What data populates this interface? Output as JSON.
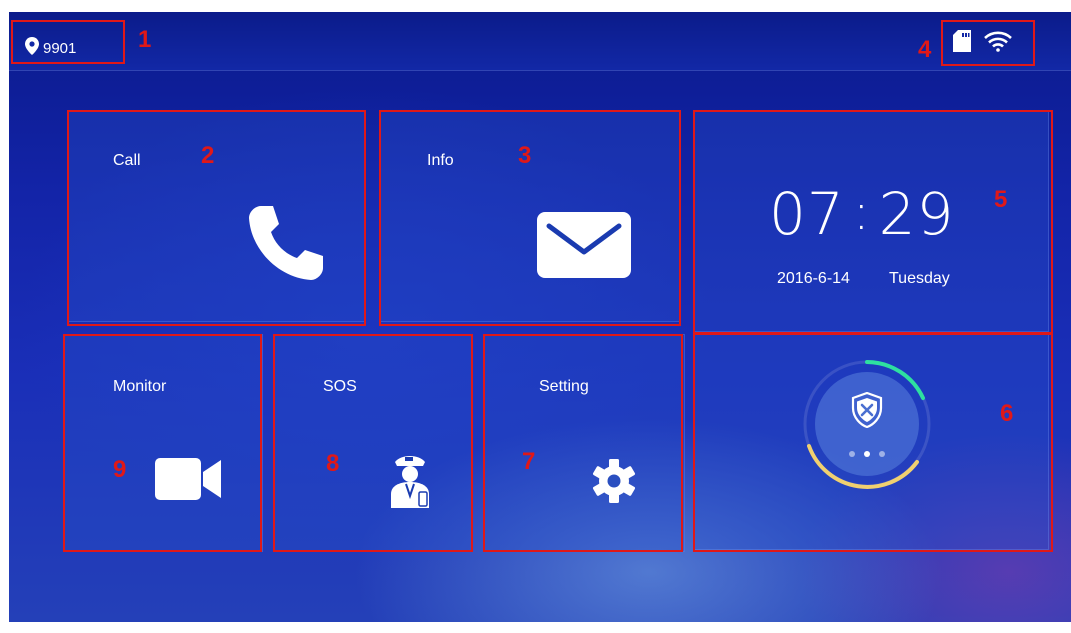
{
  "status_bar": {
    "room_number": "9901",
    "location_icon": "location-pin-icon",
    "sd_card_icon": "sd-card-icon",
    "wifi_icon": "wifi-icon"
  },
  "tiles": {
    "call": {
      "label": "Call",
      "icon": "phone-icon"
    },
    "info": {
      "label": "Info",
      "icon": "envelope-icon"
    },
    "monitor": {
      "label": "Monitor",
      "icon": "video-camera-icon"
    },
    "sos": {
      "label": "SOS",
      "icon": "security-guard-icon"
    },
    "setting": {
      "label": "Setting",
      "icon": "gear-icon"
    },
    "arm": {
      "icon": "shield-x-icon"
    }
  },
  "clock": {
    "hours": "07",
    "minutes": "29",
    "date": "2016-6-14",
    "weekday": "Tuesday"
  },
  "annotations": [
    "1",
    "2",
    "3",
    "4",
    "5",
    "6",
    "7",
    "8",
    "9"
  ],
  "colors": {
    "annotation_red": "#e01818",
    "arc_green": "#2ee0a0",
    "arc_yellow": "#f0d070"
  }
}
